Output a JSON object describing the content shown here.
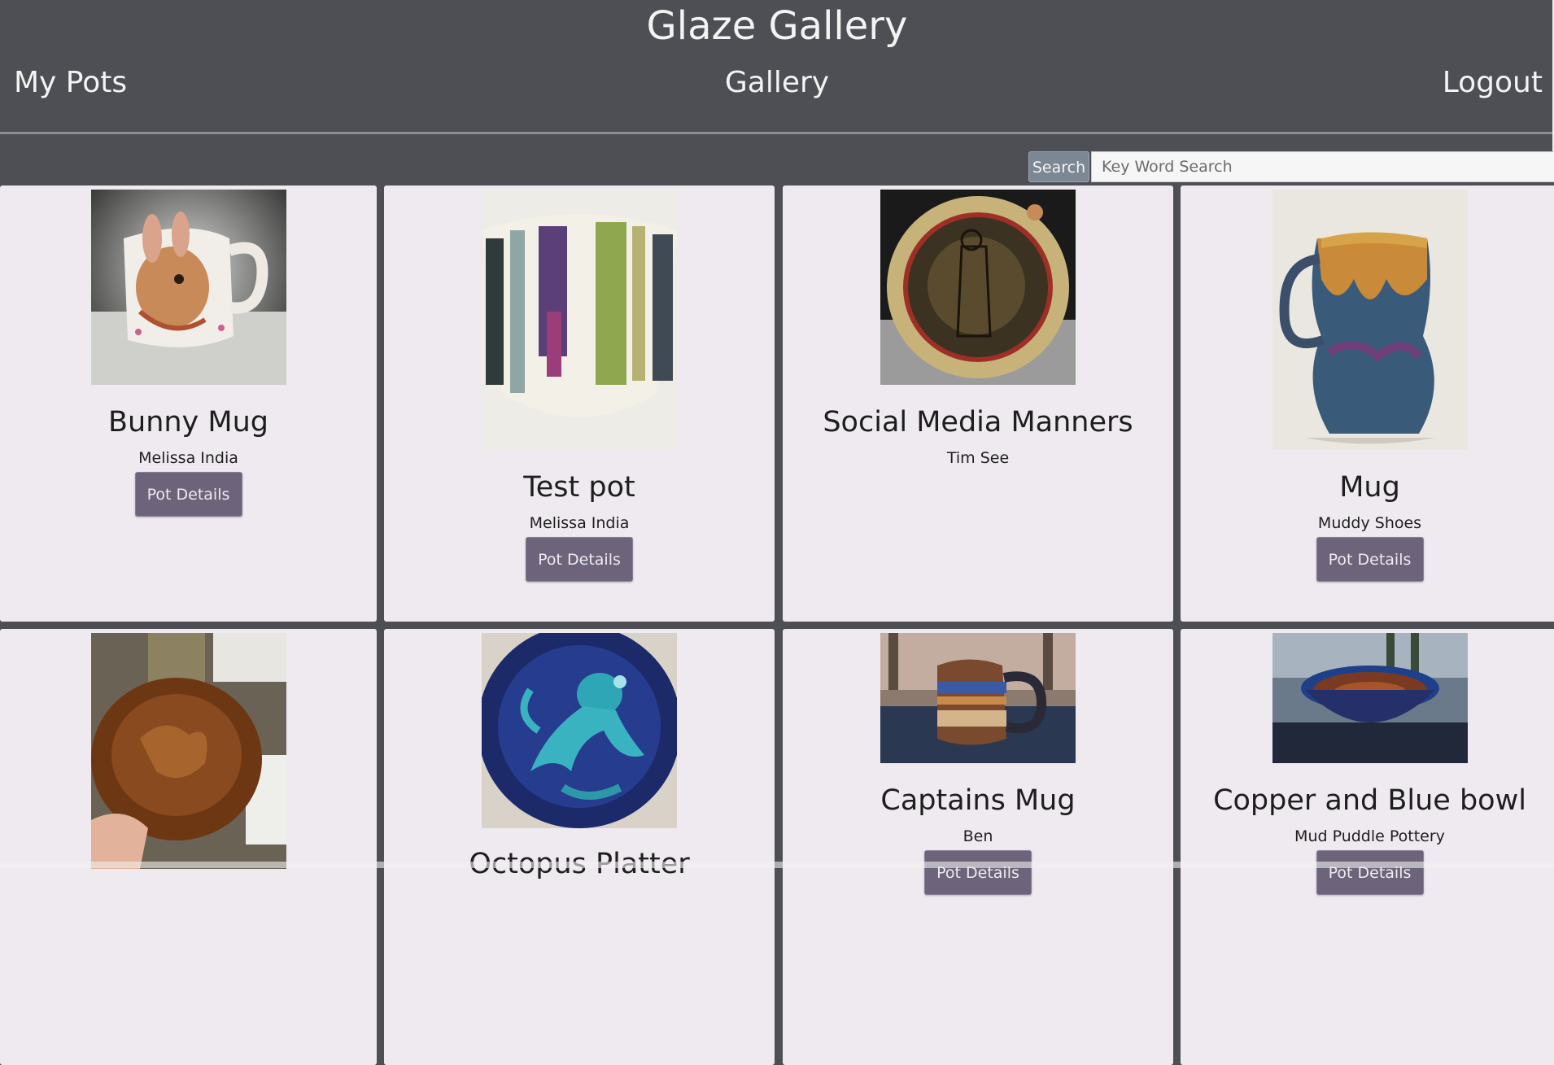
{
  "header": {
    "title": "Glaze Gallery",
    "nav": {
      "my_pots": "My Pots",
      "gallery": "Gallery",
      "logout": "Logout"
    }
  },
  "search": {
    "button_label": "Search",
    "placeholder": "Key Word Search",
    "value": ""
  },
  "pots": [
    {
      "title": "Bunny Mug",
      "artist": "Melissa India",
      "button": "Pot Details",
      "image": "bunny-mug-photo"
    },
    {
      "title": "Test pot",
      "artist": "Melissa India",
      "button": "Pot Details",
      "image": "striped-glaze-test-pot-photo"
    },
    {
      "title": "Social Media Manners",
      "artist": "Tim See",
      "button": "",
      "image": "illustrated-plate-photo"
    },
    {
      "title": "Mug",
      "artist": "Muddy Shoes",
      "button": "Pot Details",
      "image": "drip-glaze-mug-photo"
    },
    {
      "title": "",
      "artist": "",
      "button": "",
      "image": "brown-bowl-photo"
    },
    {
      "title": "Octopus Platter",
      "artist": "",
      "button": "",
      "image": "octopus-platter-photo"
    },
    {
      "title": "Captains Mug",
      "artist": "Ben",
      "button": "Pot Details",
      "image": "captains-mug-photo"
    },
    {
      "title": "Copper and Blue bowl",
      "artist": "Mud Puddle Pottery",
      "button": "Pot Details",
      "image": "copper-blue-bowl-photo"
    }
  ],
  "colors": {
    "background": "#4d4f55",
    "card": "#efeaf0",
    "button": "#6d637a",
    "search_button": "#7c8794"
  }
}
